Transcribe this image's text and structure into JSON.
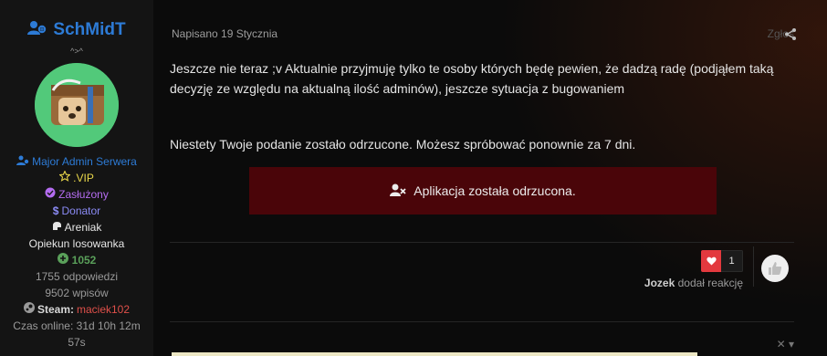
{
  "author": {
    "name": "SchMidT",
    "title": "^>^",
    "groups": {
      "primary": "Major Admin Serwera",
      "vip": ".VIP",
      "zasluzony": "Zasłużony",
      "donator": "Donator",
      "areniak": "Areniak",
      "opiekun": "Opiekun losowanka"
    },
    "reputation": "1052",
    "answers": "1755 odpowiedzi",
    "posts": "9502 wpisów",
    "steam_label": "Steam:",
    "steam_user": "maciek102",
    "online_time": "Czas online: 31d 10h 12m",
    "online_time_cont": "57s"
  },
  "post": {
    "date": "Napisano 19 Stycznia",
    "tools_label": "Zgłoś",
    "body_line1": "Jeszcze nie teraz ;v Aktualnie przyjmuję tylko te osoby których będę pewien, że dadzą radę (podjąłem taką decyzję ze względu na aktualną ilość adminów), jeszcze sytuacja z bugowaniem",
    "rejection_note": "Niestety Twoje podanie zostało odrzucone. Możesz spróbować ponownie za 7 dni.",
    "status_box": "Aplikacja została odrzucona."
  },
  "reactions": {
    "count": "1",
    "user": "Jozek",
    "action": "dodał reakcję"
  },
  "icons": {
    "author": "user-group-icon",
    "share": "share-icon",
    "reject": "user-times-icon",
    "heart": "heart-icon",
    "like": "thumbs-up-icon"
  },
  "colors": {
    "author_blue": "#2d7bd6",
    "status_box_bg": "#4a0509",
    "heart_red": "#e3393e"
  }
}
